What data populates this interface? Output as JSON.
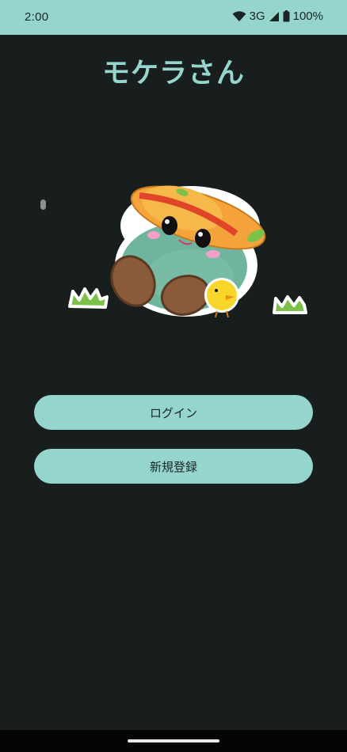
{
  "status_bar": {
    "time": "2:00",
    "network": "3G",
    "battery": "100%",
    "icons": [
      "wifi-icon",
      "signal-icon",
      "battery-icon"
    ]
  },
  "app": {
    "title": "モケラさん"
  },
  "illustration": {
    "name": "mascot-illustration"
  },
  "buttons": {
    "login": "ログイン",
    "register": "新規登録"
  },
  "colors": {
    "accent": "#95d5ce",
    "background": "#181e1e",
    "button_text": "#1b2424",
    "nav_bar": "#040606"
  }
}
